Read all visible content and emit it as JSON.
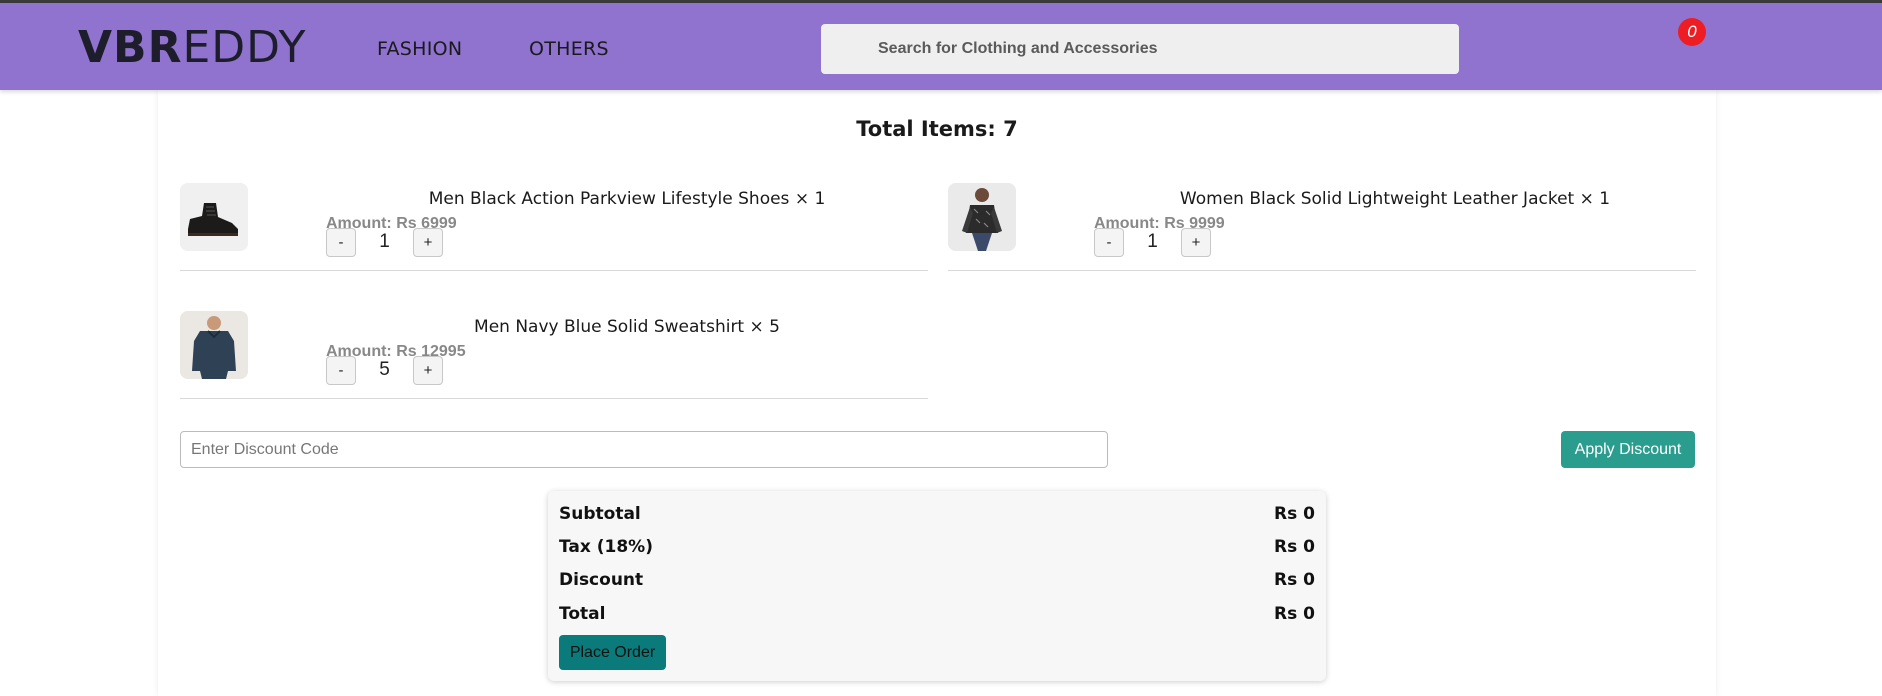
{
  "header": {
    "logo_bold": "VBR",
    "logo_light": "EDDY",
    "nav": [
      {
        "label": "FASHION"
      },
      {
        "label": "OTHERS"
      }
    ],
    "search": {
      "placeholder": "Search for Clothing and Accessories"
    },
    "cart_count": "0"
  },
  "cart": {
    "total_items": "Total Items: 7",
    "items": [
      {
        "name": "Men Black Action Parkview Lifestyle Shoes × 1",
        "amount": "Amount: Rs 6999",
        "qty": "1",
        "image": "shoe-image"
      },
      {
        "name": "Women Black Solid Lightweight Leather Jacket × 1",
        "amount": "Amount: Rs 9999",
        "qty": "1",
        "image": "jacket-image"
      },
      {
        "name": "Men Navy Blue Solid Sweatshirt × 5",
        "amount": "Amount: Rs 12995",
        "qty": "5",
        "image": "sweatshirt-image"
      }
    ],
    "minus_label": "-",
    "plus_label": "+"
  },
  "discount": {
    "placeholder": "Enter Discount Code",
    "apply_label": "Apply Discount"
  },
  "summary": {
    "rows": [
      {
        "label": "Subtotal",
        "value": "Rs 0"
      },
      {
        "label": "Tax (18%)",
        "value": "Rs 0"
      },
      {
        "label": "Discount",
        "value": "Rs 0"
      },
      {
        "label": "Total",
        "value": "Rs 0"
      }
    ],
    "place_order_label": "Place Order"
  },
  "colors": {
    "header": "#8f73cf",
    "apply_button": "#2a9d8f",
    "place_order_button": "#0a7a7a",
    "badge": "#ee1d24"
  }
}
